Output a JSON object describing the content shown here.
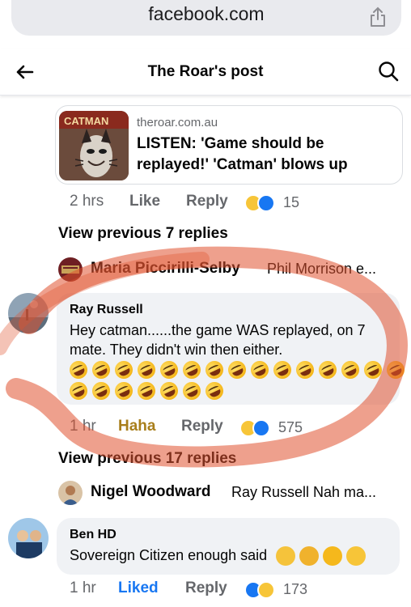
{
  "browser": {
    "url": "facebook.com"
  },
  "header": {
    "title": "The Roar's post"
  },
  "link_card": {
    "domain": "theroar.com.au",
    "title": "LISTEN: 'Game should be replayed!' 'Catman' blows up",
    "thumb_label": "CATMAN"
  },
  "post_meta": {
    "time": "2 hrs",
    "like": "Like",
    "reply": "Reply",
    "reaction_count": "15"
  },
  "view_previous_1": "View previous 7 replies",
  "reply_summary_1": {
    "name": "Maria Piccirilli-Selby",
    "snippet": "Phil Morrison e..."
  },
  "comment_1": {
    "name": "Ray Russell",
    "text": "Hey catman......the game WAS replayed, on 7 mate. They didn't win then either.",
    "emoji_rows": [
      15,
      7
    ],
    "meta": {
      "time": "1 hr",
      "reaction": "Haha",
      "reply": "Reply",
      "reaction_count": "575"
    }
  },
  "view_previous_2": "View previous 17 replies",
  "reply_summary_2": {
    "name": "Nigel Woodward",
    "snippet": "Ray Russell Nah ma..."
  },
  "comment_2": {
    "name": "Ben HD",
    "text": "Sovereign Citizen enough said",
    "meta": {
      "time": "1 hr",
      "reaction": "Liked",
      "reply": "Reply",
      "reaction_count": "173"
    }
  },
  "colors": {
    "fb_blue": "#1877f2",
    "haha_gold": "#a87e1b",
    "annotation_red": "#e0522f",
    "bubble_grey": "#f0f2f5"
  }
}
